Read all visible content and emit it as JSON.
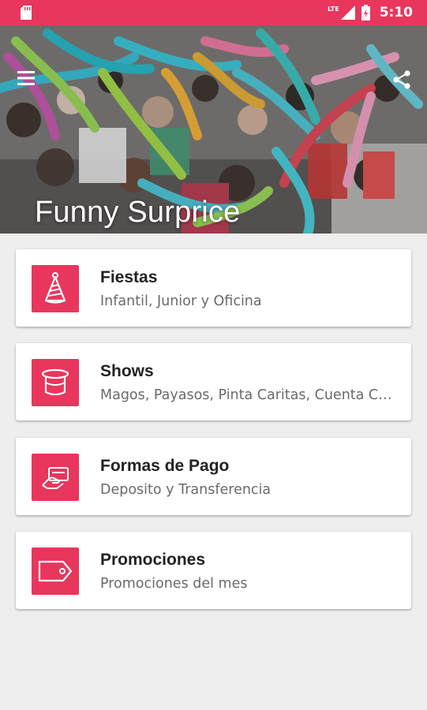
{
  "status_bar": {
    "time": "5:10",
    "network": "LTE",
    "icons": [
      "sd-card-icon",
      "signal-icon",
      "battery-icon"
    ]
  },
  "header": {
    "title": "Funny Surprice",
    "menu_icon": "menu-icon",
    "share_icon": "share-icon"
  },
  "menu": [
    {
      "title": "Fiestas",
      "subtitle": "Infantil, Junior y Oficina",
      "icon": "party-hat-icon"
    },
    {
      "title": "Shows",
      "subtitle": "Magos, Payasos, Pinta Caritas, Cuenta Cuentos",
      "icon": "magic-hat-icon"
    },
    {
      "title": "Formas de Pago",
      "subtitle": "Deposito y Transferencia",
      "icon": "payment-card-icon"
    },
    {
      "title": "Promociones",
      "subtitle": "Promociones del mes",
      "icon": "tag-icon"
    }
  ],
  "colors": {
    "accent": "#e8365d",
    "background": "#eeeeee",
    "card": "#ffffff"
  }
}
